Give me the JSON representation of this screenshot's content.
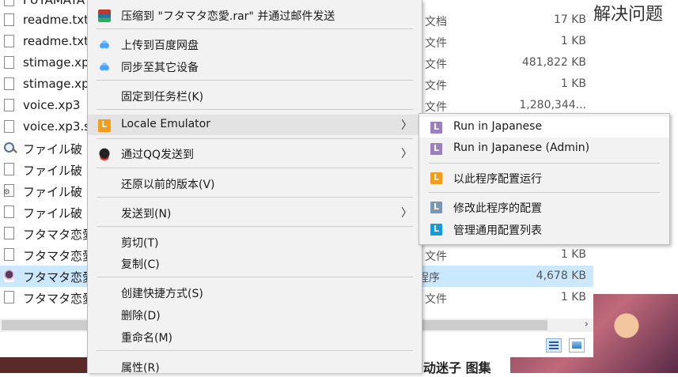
{
  "explorer": {
    "files": [
      {
        "name": "FUTAMATA",
        "type": "",
        "size": ""
      },
      {
        "name": "readme.txt",
        "type": "文档",
        "size": "17 KB"
      },
      {
        "name": "readme.txt",
        "type": "文件",
        "size": "1 KB"
      },
      {
        "name": "stimage.xp",
        "type": "文件",
        "size": "481,822 KB"
      },
      {
        "name": "stimage.xp",
        "type": "文件",
        "size": "1 KB"
      },
      {
        "name": "voice.xp3",
        "type": "文件",
        "size": "1,280,344..."
      },
      {
        "name": "voice.xp3.s",
        "type": "",
        "size": ""
      },
      {
        "name": "ファイル破",
        "type": "",
        "size": ""
      },
      {
        "name": "ファイル破",
        "type": "",
        "size": ""
      },
      {
        "name": "ファイル破",
        "type": "",
        "size": ""
      },
      {
        "name": "ファイル破",
        "type": "",
        "size": ""
      },
      {
        "name": "フタマタ恋愛",
        "type": "",
        "size": ""
      },
      {
        "name": "フタマタ恋愛",
        "type": "文件",
        "size": "1 KB"
      },
      {
        "name": "フタマタ恋愛",
        "type": "程序",
        "size": "4,678 KB"
      },
      {
        "name": "フタマタ恋愛",
        "type": "文件",
        "size": "1 KB"
      }
    ],
    "scroll_right_arrow": "›"
  },
  "background": {
    "top_right_text": "解决问题",
    "bottom_text": "动迷子 图集"
  },
  "context_menu": {
    "items": [
      {
        "label": "压缩到 \"フタマタ恋愛.rar\" 并通过邮件发送",
        "icon": "winrar-icon"
      },
      {
        "label": "上传到百度网盘",
        "icon": "baidu-netdisk-icon"
      },
      {
        "label": "同步至其它设备",
        "icon": "baidu-sync-icon"
      },
      {
        "label": "固定到任务栏(K)",
        "icon": ""
      },
      {
        "label": "Locale Emulator",
        "icon": "locale-emulator-icon"
      },
      {
        "label": "通过QQ发送到",
        "icon": "qq-icon"
      },
      {
        "label": "还原以前的版本(V)",
        "icon": ""
      },
      {
        "label": "发送到(N)",
        "icon": ""
      },
      {
        "label": "剪切(T)",
        "icon": ""
      },
      {
        "label": "复制(C)",
        "icon": ""
      },
      {
        "label": "创建快捷方式(S)",
        "icon": ""
      },
      {
        "label": "删除(D)",
        "icon": ""
      },
      {
        "label": "重命名(M)",
        "icon": ""
      },
      {
        "label": "属性(R)",
        "icon": ""
      }
    ],
    "submenu_arrow": "〉"
  },
  "sub_menu": {
    "items": [
      {
        "label": "Run in Japanese",
        "icon": "le-run-icon"
      },
      {
        "label": "Run in Japanese (Admin)",
        "icon": "le-run-admin-icon"
      },
      {
        "label": "以此程序配置运行",
        "icon": "le-config-run-icon"
      },
      {
        "label": "修改此程序的配置",
        "icon": "le-modify-config-icon"
      },
      {
        "label": "管理通用配置列表",
        "icon": "le-manage-list-icon"
      }
    ]
  }
}
